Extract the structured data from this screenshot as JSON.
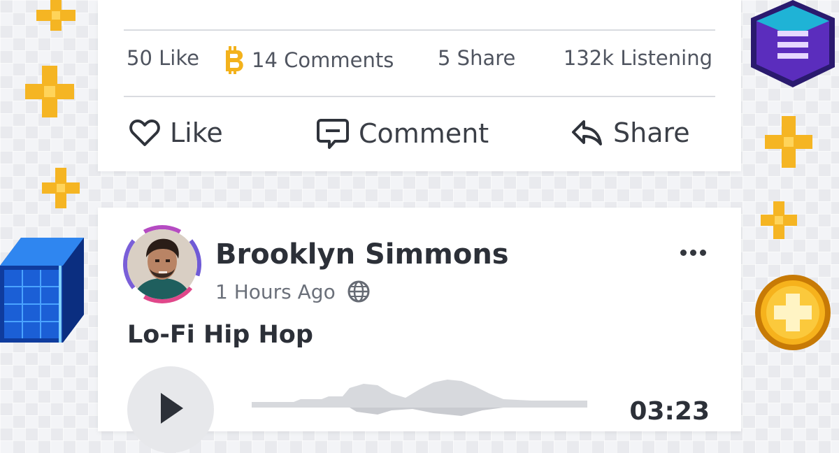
{
  "top_post": {
    "stats": {
      "likes": "50 Like",
      "comments": "14 Comments",
      "shares": "5 Share",
      "listening": "132k Listening"
    },
    "actions": {
      "like": "Like",
      "comment": "Comment",
      "share": "Share"
    }
  },
  "post": {
    "author": "Brooklyn Simmons",
    "time": "1 Hours Ago",
    "title": "Lo-Fi Hip Hop",
    "duration": "03:23"
  },
  "icons": {
    "coin": "bitcoin-coin-icon",
    "like": "heart-icon",
    "comment": "comment-bubble-icon",
    "share": "share-arrow-icon",
    "globe": "globe-icon",
    "more": "more-dots-icon",
    "play": "play-icon"
  },
  "colors": {
    "accent_gold": "#f3b21c",
    "cube_blue": "#1f6fe0",
    "hex_purple": "#5b2dbd",
    "text_dark": "#2c3038"
  }
}
